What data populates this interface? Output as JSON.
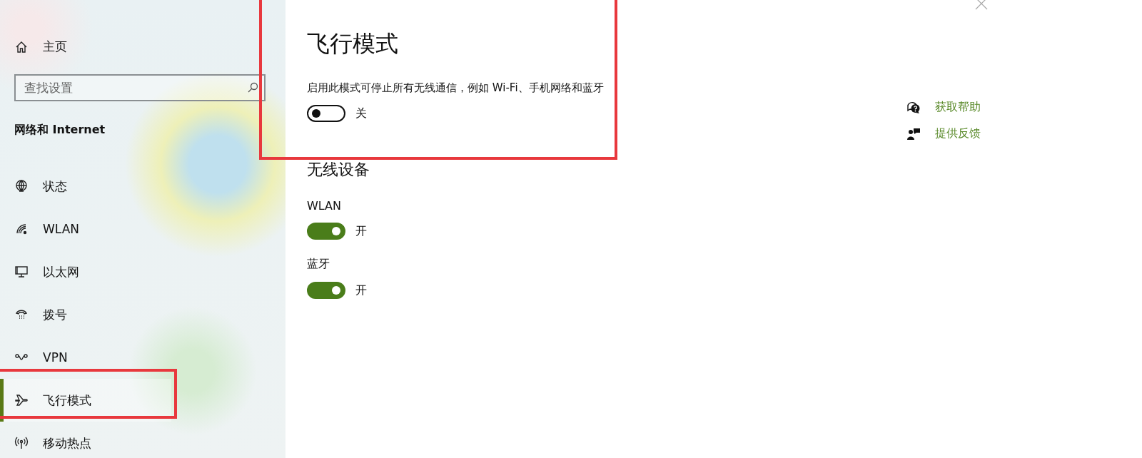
{
  "sidebar": {
    "home": {
      "label": "主页",
      "kind": "home"
    },
    "search": {
      "placeholder": "查找设置"
    },
    "section_title": "网络和 Internet",
    "items": [
      {
        "label": "状态",
        "kind": "globe",
        "selected": false
      },
      {
        "label": "WLAN",
        "kind": "wifi",
        "selected": false
      },
      {
        "label": "以太网",
        "kind": "ethernet",
        "selected": false
      },
      {
        "label": "拨号",
        "kind": "dialup",
        "selected": false
      },
      {
        "label": "VPN",
        "kind": "vpn",
        "selected": false
      },
      {
        "label": "飞行模式",
        "kind": "plane",
        "selected": true
      },
      {
        "label": "移动热点",
        "kind": "hotspot",
        "selected": false
      }
    ]
  },
  "main": {
    "title": "飞行模式",
    "description": "启用此模式可停止所有无线通信，例如 Wi-Fi、手机网络和蓝牙",
    "toggle": {
      "on": false,
      "state_label": "关"
    },
    "section_title": "无线设备",
    "devices": [
      {
        "name": "WLAN",
        "on": true,
        "state_label": "开"
      },
      {
        "name": "蓝牙",
        "on": true,
        "state_label": "开"
      }
    ]
  },
  "help_links": [
    {
      "label": "获取帮助",
      "kind": "help"
    },
    {
      "label": "提供反馈",
      "kind": "feedback"
    }
  ],
  "annotations": [
    {
      "kind": "rectangle"
    },
    {
      "kind": "rectangle"
    }
  ]
}
